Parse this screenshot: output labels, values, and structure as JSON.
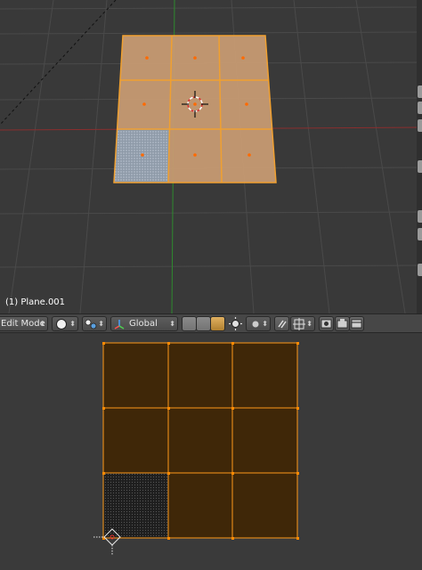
{
  "viewport": {
    "object_label": "(1) Plane.001",
    "colors": {
      "background": "#393939",
      "grid": "#4a4a4a",
      "x_axis": "#8a2e2e",
      "y_axis": "#2e8a2e",
      "face_selected": "#c69a72",
      "edge_selected": "#f0a030",
      "vertex": "#ff8c00"
    }
  },
  "header": {
    "mode_label": "Edit Mode",
    "shading_icon": "sphere-solid-icon",
    "pivot_icon": "pivot-point-icon",
    "orientation_label": "Global",
    "icons": [
      "translate-widget-icon",
      "rotate-widget-icon",
      "scale-widget-icon",
      "layer-icon",
      "proportional-edit-icon",
      "snap-icon",
      "snap-target-icon",
      "render-icon",
      "camera-icon"
    ]
  },
  "uv_editor": {
    "colors": {
      "background": "#3a3a3a",
      "face_fill": "#3f2708",
      "edge": "#ff9a1a",
      "vertex": "#ff8a00",
      "cursor": "#dddddd"
    }
  }
}
